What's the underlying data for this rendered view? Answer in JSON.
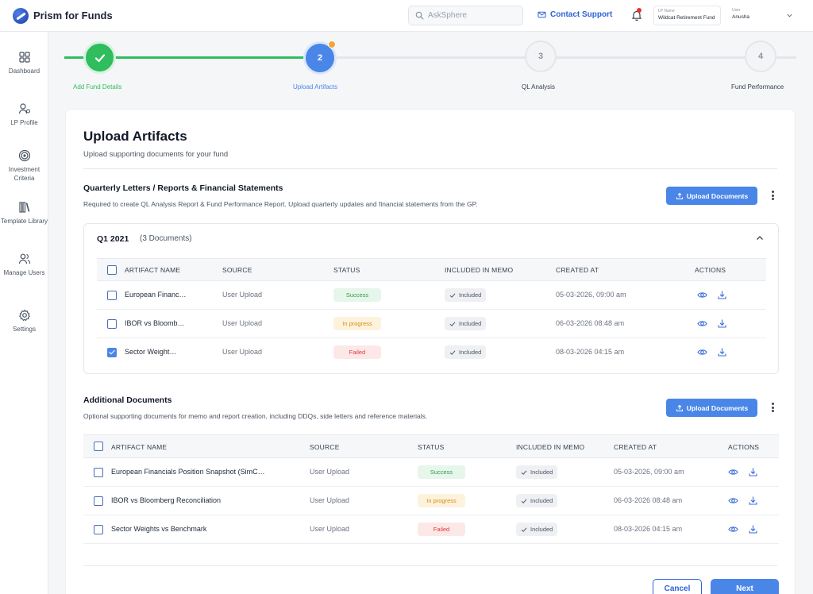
{
  "app": {
    "name": "Prism for Funds"
  },
  "header": {
    "search_placeholder": "AskSphere",
    "contact_label": "Contact Support",
    "fund_caption": "LP Name",
    "fund_value": "Wildcat Retirement Fund",
    "user_caption": "User",
    "user_value": "Anusha"
  },
  "sidebar": {
    "items": [
      {
        "label": "Dashboard",
        "icon": "grid-icon"
      },
      {
        "label": "LP Profile",
        "icon": "user-settings-icon"
      },
      {
        "label": "Investment Criteria",
        "icon": "target-icon"
      },
      {
        "label": "Template Library",
        "icon": "library-icon"
      },
      {
        "label": "Manage Users",
        "icon": "users-icon"
      },
      {
        "label": "Settings",
        "icon": "gear-icon"
      }
    ]
  },
  "stepper": {
    "steps": [
      {
        "number": "1",
        "label": "Add Fund Details",
        "state": "completed"
      },
      {
        "number": "2",
        "label": "Upload Artifacts",
        "state": "active"
      },
      {
        "number": "3",
        "label": "QL Analysis",
        "state": "pending"
      },
      {
        "number": "4",
        "label": "Fund Performance",
        "state": "pending"
      }
    ]
  },
  "page": {
    "title": "Upload Artifacts",
    "subtitle": "Upload supporting documents for your fund"
  },
  "section1": {
    "title": "Quarterly Letters / Reports & Financial Statements",
    "description": "Required to create QL Analysis Report & Fund Performance Report. Upload quarterly updates and financial statements from the GP.",
    "upload_label": "Upload Documents",
    "group": {
      "title": "Q1 2021",
      "count": "(3 Documents)",
      "columns": [
        "ARTIFACT NAME",
        "SOURCE",
        "STATUS",
        "INCLUDED IN MEMO",
        "CREATED AT",
        "ACTIONS"
      ],
      "rows": [
        {
          "name": "European Financ…",
          "source": "User Upload",
          "status": "Success",
          "memo": "Included",
          "created": "05-03-2026, 09:00 am",
          "checked": false
        },
        {
          "name": "IBOR vs Bloomb…",
          "source": "User Upload",
          "status": "In progress",
          "memo": "Included",
          "created": "06-03-2026 08:48 am",
          "checked": false
        },
        {
          "name": "Sector Weight…",
          "source": "User Upload",
          "status": "Failed",
          "memo": "Included",
          "created": "08-03-2026 04:15 am",
          "checked": true
        }
      ]
    }
  },
  "section2": {
    "title": "Additional Documents",
    "description": "Optional supporting documents for memo and report creation, including DDQs, side letters and reference materials.",
    "upload_label": "Upload Documents",
    "columns": [
      "ARTIFACT NAME",
      "SOURCE",
      "STATUS",
      "INCLUDED IN MEMO",
      "CREATED AT",
      "ACTIONS"
    ],
    "rows": [
      {
        "name": "European Financials Position Snapshot (SimC…",
        "source": "User Upload",
        "status": "Success",
        "memo": "Included",
        "created": "05-03-2026, 09:00 am",
        "checked": false
      },
      {
        "name": "IBOR vs Bloomberg Reconciliation",
        "source": "User Upload",
        "status": "In progress",
        "memo": "Included",
        "created": "06-03-2026 08:48 am",
        "checked": false
      },
      {
        "name": "Sector Weights vs Benchmark",
        "source": "User Upload",
        "status": "Failed",
        "memo": "Included",
        "created": "08-03-2026 04:15 am",
        "checked": false
      }
    ]
  },
  "footer": {
    "cancel_label": "Cancel",
    "next_label": "Next"
  },
  "colors": {
    "accent": "#4a86e8",
    "success": "#2fbd5d",
    "progress": "#d98a13",
    "failed": "#dc3a3a"
  }
}
